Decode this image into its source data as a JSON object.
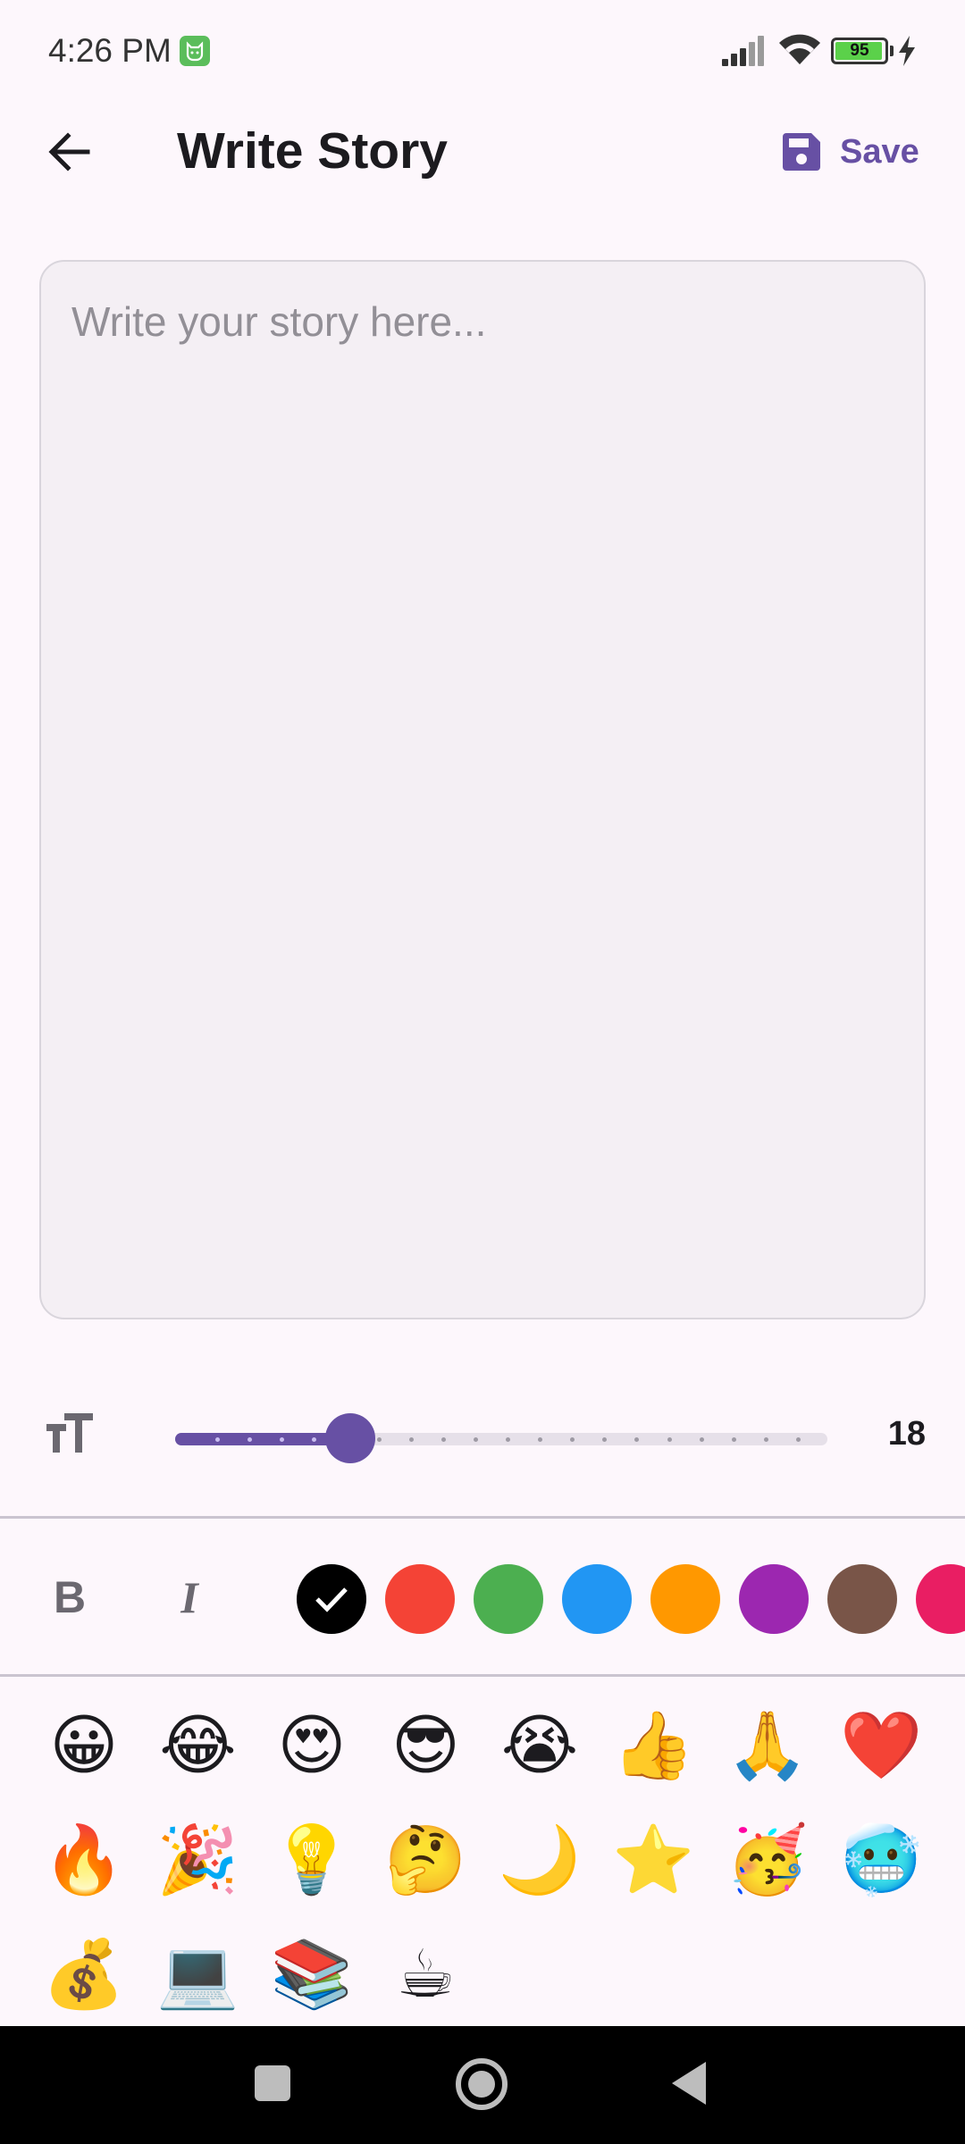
{
  "status_bar": {
    "time": "4:26 PM",
    "app_icon": "cat-icon",
    "signal_icon": "signal-icon",
    "wifi_icon": "wifi-icon",
    "battery_level": "95",
    "charging_icon": "bolt-icon"
  },
  "app_bar": {
    "back_icon": "arrow-left-icon",
    "title": "Write Story",
    "save_icon": "floppy-disk-icon",
    "save_label": "Save"
  },
  "editor": {
    "placeholder": "Write your story here...",
    "value": ""
  },
  "font_size": {
    "icon": "text-size-icon",
    "value": "18",
    "min": 12,
    "max": 30,
    "current": 18
  },
  "toolbar": {
    "bold_label": "B",
    "italic_label": "I",
    "colors": [
      {
        "name": "black",
        "hex": "#000000",
        "selected": true
      },
      {
        "name": "red",
        "hex": "#f44336",
        "selected": false
      },
      {
        "name": "green",
        "hex": "#4caf50",
        "selected": false
      },
      {
        "name": "blue",
        "hex": "#2196f3",
        "selected": false
      },
      {
        "name": "orange",
        "hex": "#ff9800",
        "selected": false
      },
      {
        "name": "purple",
        "hex": "#9c27b0",
        "selected": false
      },
      {
        "name": "brown",
        "hex": "#795548",
        "selected": false
      },
      {
        "name": "pink",
        "hex": "#e91e63",
        "selected": false
      }
    ]
  },
  "emojis": [
    "😀",
    "😂",
    "😍",
    "😎",
    "😭",
    "👍",
    "🙏",
    "❤️",
    "🔥",
    "🎉",
    "💡",
    "🤔",
    "🌙",
    "⭐",
    "🥳",
    "🥶",
    "💰",
    "💻",
    "📚",
    "☕"
  ],
  "theme": {
    "accent": "#6750a4",
    "background": "#fdf7fc",
    "input_bg": "#f4eff4"
  }
}
